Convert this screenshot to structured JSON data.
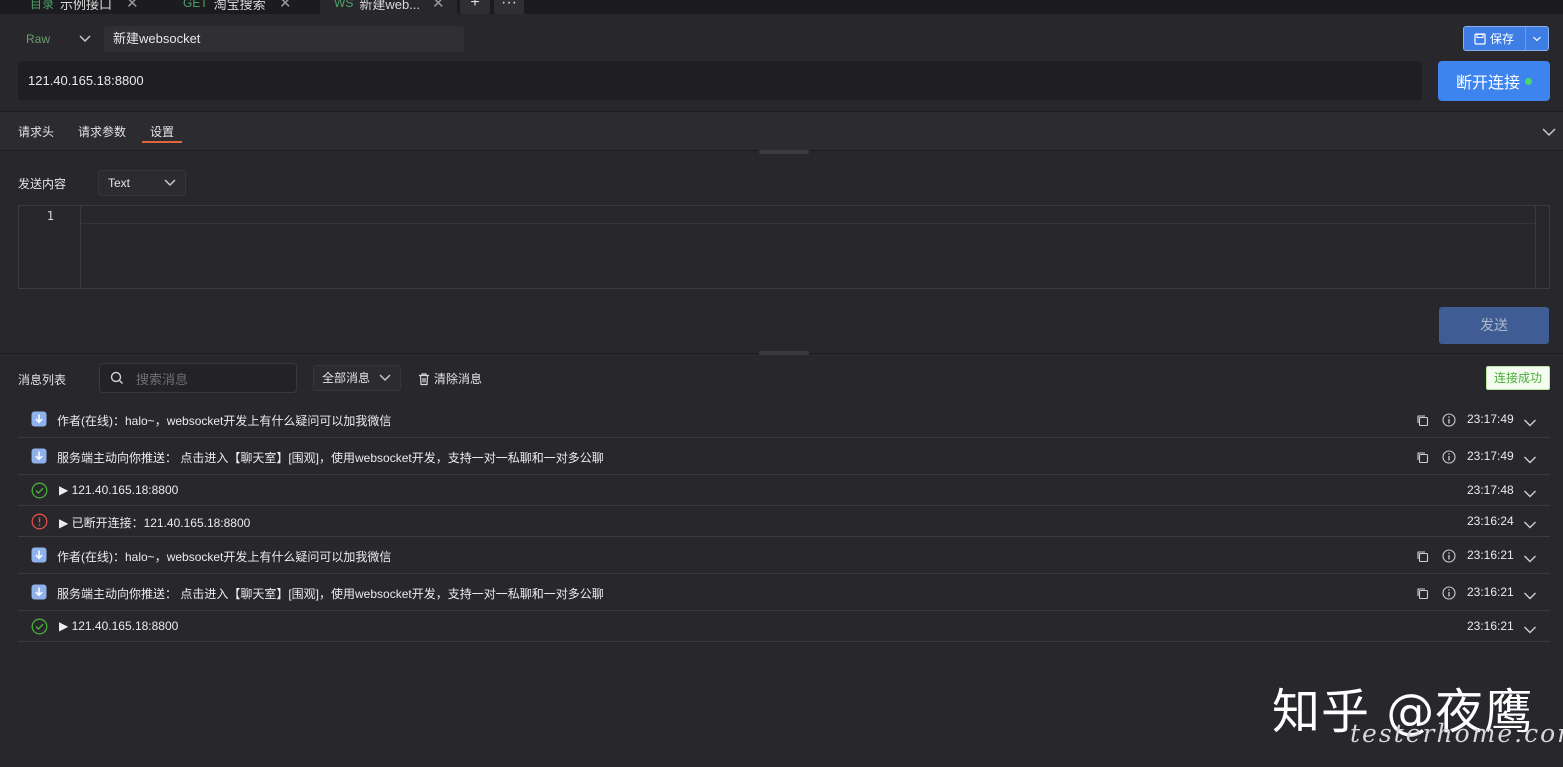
{
  "tabs": [
    {
      "method": "目录",
      "label": "示例接口",
      "method_color": "#4aa36a"
    },
    {
      "method": "GET",
      "label": "淘宝搜索",
      "method_color": "#4aa36a"
    },
    {
      "method": "WS",
      "label": "新建web...",
      "method_color": "#4aa36a",
      "active": true
    }
  ],
  "tab_add": "+",
  "tab_more": "···",
  "request": {
    "mode": "Raw",
    "name": "新建websocket",
    "save_label": "保存",
    "url": "121.40.165.18:8800",
    "disconnect_label": "断开连接"
  },
  "subtabs": [
    "请求头",
    "请求参数",
    "设置"
  ],
  "send_panel": {
    "label": "发送内容",
    "type": "Text",
    "line_number": "1",
    "send_label": "发送"
  },
  "messages_panel": {
    "label": "消息列表",
    "search_placeholder": "搜索消息",
    "filter": "全部消息",
    "clear_label": "清除消息",
    "status": "连接成功"
  },
  "messages": [
    {
      "kind": "received",
      "text": "作者(在线)：halo~，websocket开发上有什么疑问可以加我微信",
      "time": "23:17:49"
    },
    {
      "kind": "received",
      "text": "服务端主动向你推送： 点击进入【聊天室】[围观]，使用websocket开发，支持一对一私聊和一对多公聊",
      "time": "23:17:49"
    },
    {
      "kind": "connected",
      "text": "▶ 121.40.165.18:8800",
      "time": "23:17:48"
    },
    {
      "kind": "disconnected",
      "text": "▶ 已断开连接：121.40.165.18:8800",
      "time": "23:16:24"
    },
    {
      "kind": "received",
      "text": "作者(在线)：halo~，websocket开发上有什么疑问可以加我微信",
      "time": "23:16:21"
    },
    {
      "kind": "received",
      "text": "服务端主动向你推送： 点击进入【聊天室】[围观]，使用websocket开发，支持一对一私聊和一对多公聊",
      "time": "23:16:21"
    },
    {
      "kind": "connected",
      "text": "▶ 121.40.165.18:8800",
      "time": "23:16:21"
    }
  ],
  "watermark": {
    "main": "知乎 @夜鹰",
    "sub": "testerhome.com"
  },
  "colors": {
    "accent": "#3e84ee",
    "success": "#4aad3a",
    "error": "#e0514a",
    "active_tab_underline": "#e0663a"
  },
  "icons": {
    "received": "download-arrow-icon",
    "connected": "check-circle-icon",
    "disconnected": "alert-circle-icon",
    "copy": "copy-icon",
    "info": "info-icon",
    "expand": "chevron-down-icon"
  }
}
